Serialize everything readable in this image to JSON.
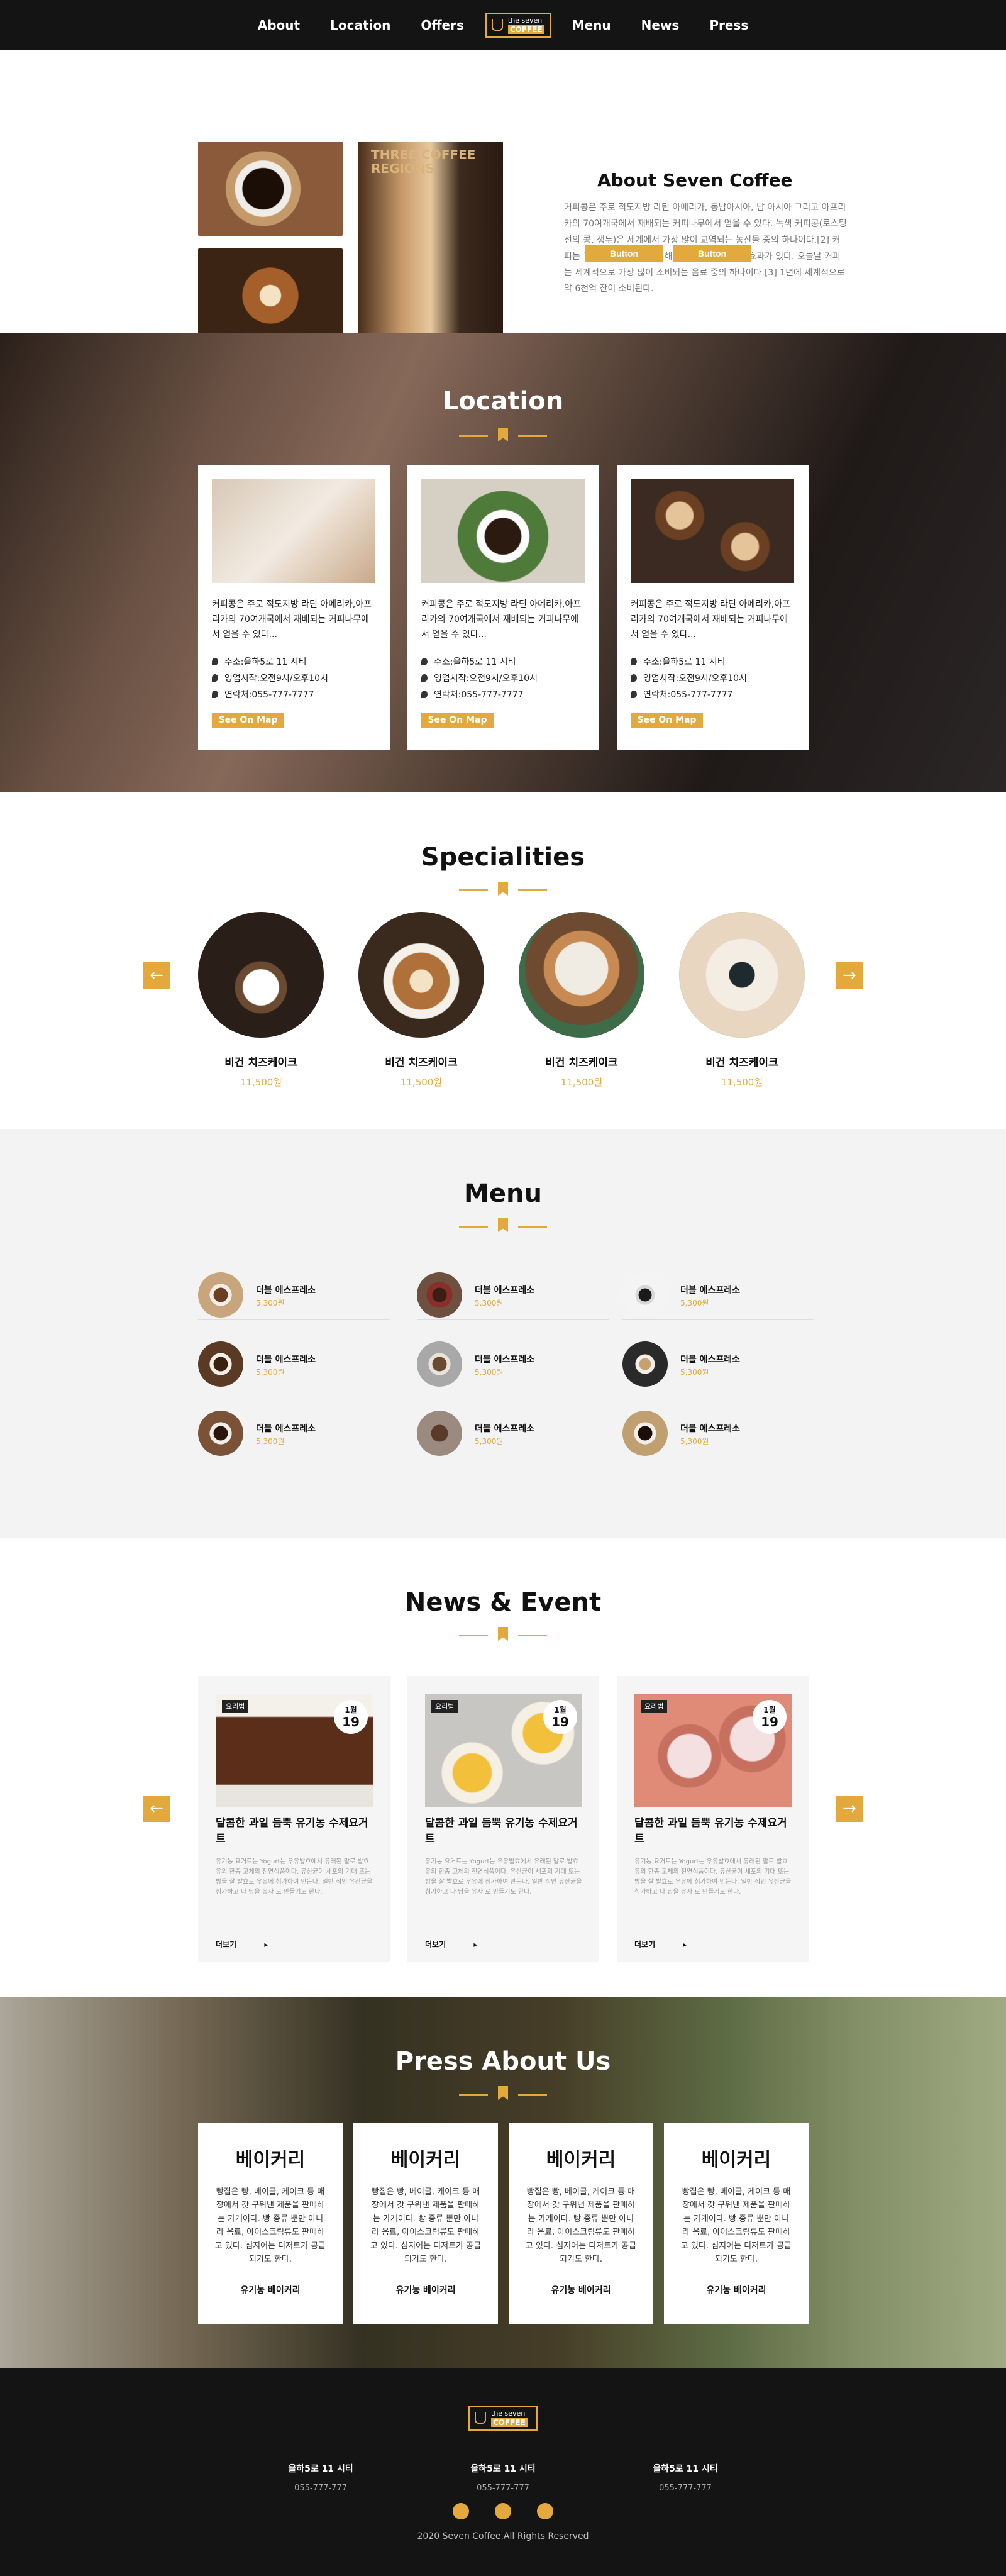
{
  "nav": {
    "items": [
      "About",
      "Location",
      "Offers",
      "Menu",
      "News",
      "Press"
    ],
    "logo_top": "the seven",
    "logo_bottom": "COFFEE"
  },
  "about": {
    "photo_sign": "THREE COFFEE REGIONS",
    "title": "About Seven Coffee",
    "text": "커피콩은 주로 적도지방 라틴 아메리카, 동남아시아, 남 아시아 그리고 아프리카의 70여개국에서 재배되는 커피나무에서 얻을 수 있다. 녹색 커피콩(로스팅 전의 콩, 생두)은 세계에서 가장 많이 교역되는 농산물 중의 하나이다.[2] 커피는 그 카페인 성분으로 인해 사람을 흥분 시키는 효과가 있다. 오늘날 커피는 세계적으로 가장 많이 소비되는 음료 중의 하나이다.[3] 1년에 세계적으로 약 6천억 잔이 소비된다.",
    "button1": "Button",
    "button2": "Button"
  },
  "location": {
    "title": "Location",
    "cards": [
      {
        "desc": "커피콩은 주로 적도지방 라틴 아메리카,아프리카의 70여개국에서 재배되는 커피나무에서 얻을 수 있다...",
        "address": "주소:을하5로 11 시티",
        "hours": "영업시작:오전9시/오후10시",
        "phone": "연락처:055-777-7777",
        "map": "See On Map"
      },
      {
        "desc": "커피콩은 주로 적도지방 라틴 아메리카,아프리카의 70여개국에서 재배되는 커피나무에서 얻을 수 있다...",
        "address": "주소:을하5로 11 시티",
        "hours": "영업시작:오전9시/오후10시",
        "phone": "연락처:055-777-7777",
        "map": "See On Map"
      },
      {
        "desc": "커피콩은 주로 적도지방 라틴 아메리카,아프리카의 70여개국에서 재배되는 커피나무에서 얻을 수 있다...",
        "address": "주소:을하5로 11 시티",
        "hours": "영업시작:오전9시/오후10시",
        "phone": "연락처:055-777-7777",
        "map": "See On Map"
      }
    ]
  },
  "specialities": {
    "title": "Specialities",
    "items": [
      {
        "name": "비건 치즈케이크",
        "price": "11,500원"
      },
      {
        "name": "비건 치즈케이크",
        "price": "11,500원"
      },
      {
        "name": "비건 치즈케이크",
        "price": "11,500원"
      },
      {
        "name": "비건 치즈케이크",
        "price": "11,500원"
      }
    ],
    "prev": "←",
    "next": "→"
  },
  "menu": {
    "title": "Menu",
    "items": [
      {
        "name": "더블 에스프레소",
        "price": "5,300원"
      },
      {
        "name": "더블 에스프레소",
        "price": "5,300원"
      },
      {
        "name": "더블 에스프레소",
        "price": "5,300원"
      },
      {
        "name": "더블 에스프레소",
        "price": "5,300원"
      },
      {
        "name": "더블 에스프레소",
        "price": "5,300원"
      },
      {
        "name": "더블 에스프레소",
        "price": "5,300원"
      },
      {
        "name": "더블 에스프레소",
        "price": "5,300원"
      },
      {
        "name": "더블 에스프레소",
        "price": "5,300원"
      },
      {
        "name": "더블 에스프레소",
        "price": "5,300원"
      }
    ]
  },
  "news": {
    "title": "News & Event",
    "cards": [
      {
        "tag": "요리법",
        "month": "1월",
        "day": "19",
        "title": "달콤한 과일 듬뿍 유기농 수제요거트",
        "summary": "유기농 요거트는 Yogurt는 우유발효에서 유래된 말로 발효유의 한종 고체의 천연식품이다. 유산균이 세포의 기대 또는 방울 잘 발효로 우유에 첨가하여 만든다. 일반 적인 유산균을 첨가하고 다 당을 유자 로 만들기도 한다.",
        "more": "더보기"
      },
      {
        "tag": "요리법",
        "month": "1월",
        "day": "19",
        "title": "달콤한 과일 듬뿍 유기농 수제요거트",
        "summary": "유기농 요거트는 Yogurt는 우유발효에서 유래된 말로 발효유의 한종 고체의 천연식품이다. 유산균이 세포의 기대 또는 방울 잘 발효로 우유에 첨가하여 만든다. 일반 적인 유산균을 첨가하고 다 당을 유자 로 만들기도 한다.",
        "more": "더보기"
      },
      {
        "tag": "요리법",
        "month": "1월",
        "day": "19",
        "title": "달콤한 과일 듬뿍 유기농 수제요거트",
        "summary": "유기농 요거트는 Yogurt는 우유발효에서 유래된 말로 발효유의 한종 고체의 천연식품이다. 유산균이 세포의 기대 또는 방울 잘 발효로 우유에 첨가하여 만든다. 일반 적인 유산균을 첨가하고 다 당을 유자 로 만들기도 한다.",
        "more": "더보기"
      }
    ],
    "prev": "←",
    "next": "→"
  },
  "press": {
    "title": "Press About Us",
    "cards": [
      {
        "heading": "베이커리",
        "text": "빵집은 빵, 베이글, 케이크 등 매장에서 갓 구워낸 제품을 판매하는 가게이다. 빵 종류 뿐만 아니라 음료, 아이스크림류도 판매하고 있다. 심지어는 디저트가 공급되기도 한다.",
        "footer": "유기농 베이커리"
      },
      {
        "heading": "베이커리",
        "text": "빵집은 빵, 베이글, 케이크 등 매장에서 갓 구워낸 제품을 판매하는 가게이다. 빵 종류 뿐만 아니라 음료, 아이스크림류도 판매하고 있다. 심지어는 디저트가 공급되기도 한다.",
        "footer": "유기농 베이커리"
      },
      {
        "heading": "베이커리",
        "text": "빵집은 빵, 베이글, 케이크 등 매장에서 갓 구워낸 제품을 판매하는 가게이다. 빵 종류 뿐만 아니라 음료, 아이스크림류도 판매하고 있다. 심지어는 디저트가 공급되기도 한다.",
        "footer": "유기농 베이커리"
      },
      {
        "heading": "베이커리",
        "text": "빵집은 빵, 베이글, 케이크 등 매장에서 갓 구워낸 제품을 판매하는 가게이다. 빵 종류 뿐만 아니라 음료, 아이스크림류도 판매하고 있다. 심지어는 디저트가 공급되기도 한다.",
        "footer": "유기농 베이커리"
      }
    ]
  },
  "footer": {
    "logo_top": "the seven",
    "logo_bottom": "COFFEE",
    "columns": [
      {
        "address": "을하5로 11 시티",
        "phone": "055-777-777"
      },
      {
        "address": "을하5로 11 시티",
        "phone": "055-777-777"
      },
      {
        "address": "을하5로 11 시티",
        "phone": "055-777-777"
      }
    ],
    "copyright": "2020 Seven Coffee.All Rights Reserved"
  },
  "colors": {
    "accent": "#e3a93c",
    "dark": "#141414",
    "menu_bg": "#f3f3f3"
  }
}
